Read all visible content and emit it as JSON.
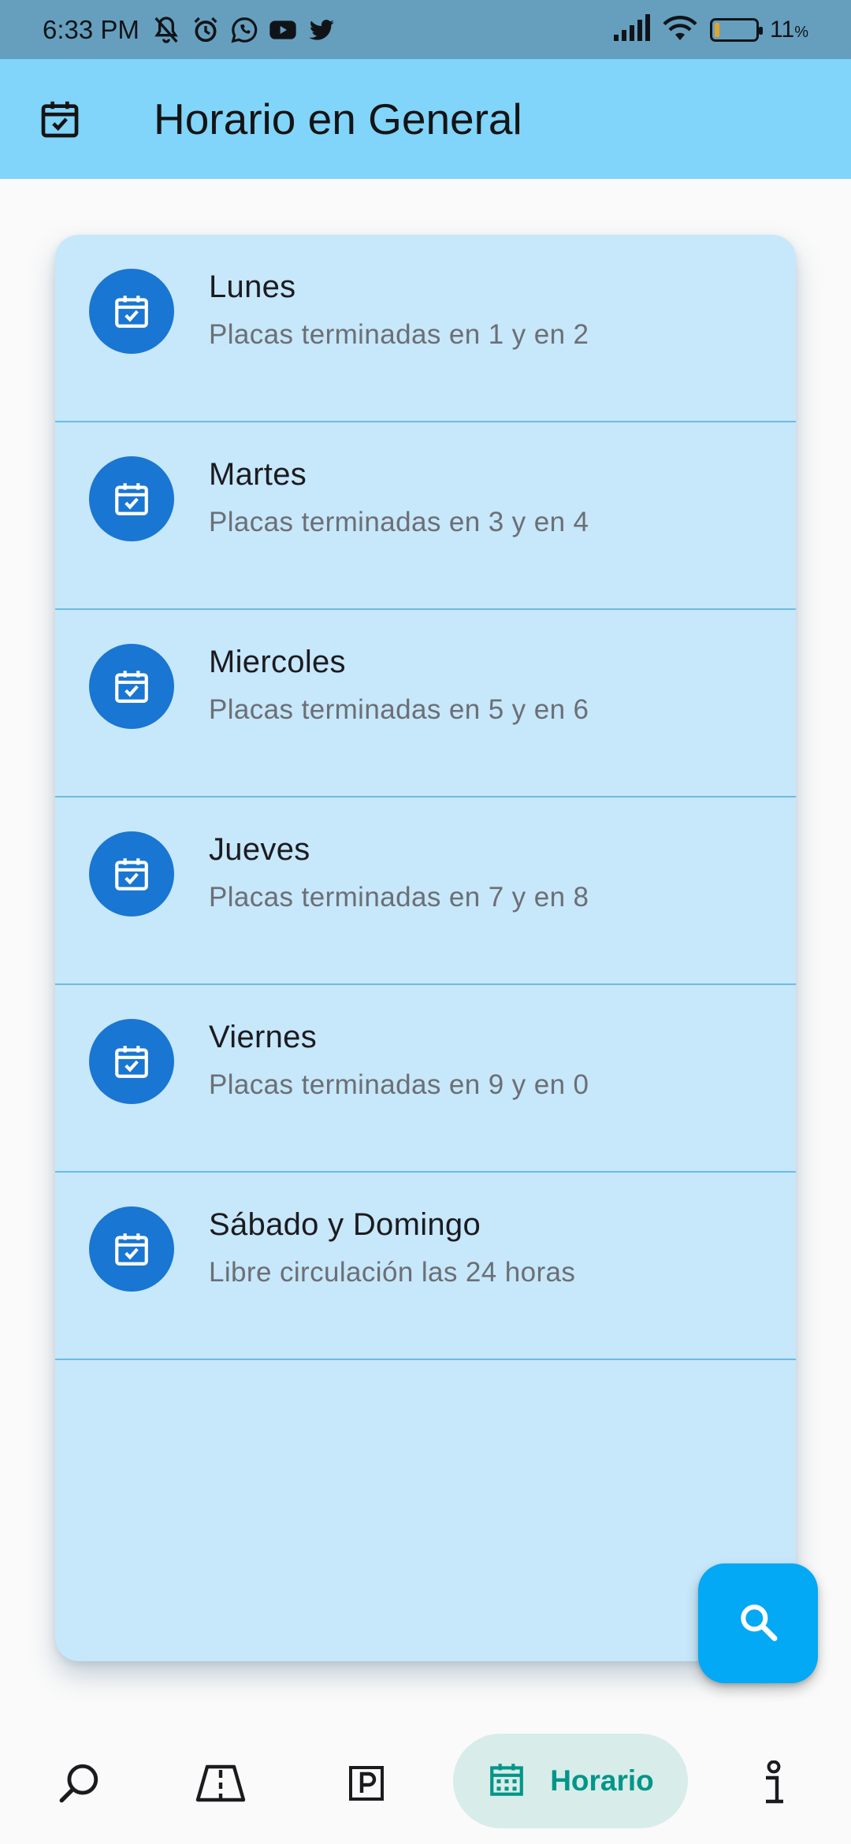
{
  "status_bar": {
    "time": "6:33 PM",
    "battery_percent": "11",
    "battery_unit": "%",
    "battery_level": 0.11,
    "icons": [
      "muted-bell-icon",
      "alarm-icon",
      "whatsapp-icon",
      "youtube-icon",
      "twitter-icon",
      "signal-icon",
      "wifi-icon",
      "battery-icon"
    ]
  },
  "app_bar": {
    "title": "Horario en General",
    "icon": "calendar-check-icon"
  },
  "schedule": {
    "items": [
      {
        "title": "Lunes",
        "subtitle": "Placas terminadas en 1 y en 2"
      },
      {
        "title": "Martes",
        "subtitle": "Placas terminadas en 3 y en 4"
      },
      {
        "title": "Miercoles",
        "subtitle": "Placas terminadas en 5 y en 6"
      },
      {
        "title": "Jueves",
        "subtitle": "Placas terminadas en 7 y en 8"
      },
      {
        "title": "Viernes",
        "subtitle": "Placas terminadas en 9 y en 0"
      },
      {
        "title": "Sábado y Domingo",
        "subtitle": "Libre circulación las 24 horas"
      }
    ]
  },
  "fab": {
    "icon": "search-icon"
  },
  "bottom_nav": {
    "items": [
      {
        "icon": "search-icon"
      },
      {
        "icon": "road-icon"
      },
      {
        "icon": "parking-icon"
      },
      {
        "icon": "calendar-grid-icon",
        "label": "Horario",
        "active": true
      },
      {
        "icon": "info-icon"
      }
    ]
  },
  "colors": {
    "status_bar": "#669fbe",
    "app_bar": "#81d4fa",
    "card": "#c7e7fa",
    "avatar": "#1976d2",
    "fab": "#03a9f4",
    "nav_active_bg": "#d8ecea",
    "nav_active_fg": "#009688"
  }
}
